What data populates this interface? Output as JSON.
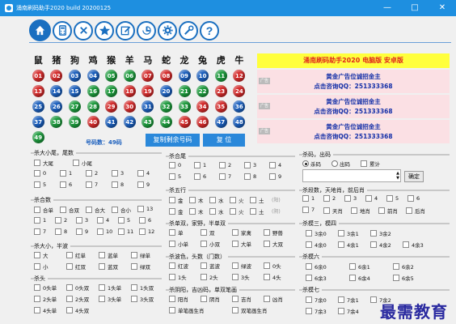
{
  "window": {
    "title": "涌南刷码助手2020 build 20200125",
    "min_glyph": "—",
    "max_glyph": "□",
    "close_glyph": "✕"
  },
  "toolbar": {
    "icons": [
      "home-icon",
      "calculator-icon",
      "close-circle-icon",
      "star-icon",
      "edit-icon",
      "clock-icon",
      "gear-icon",
      "tools-icon",
      "help-icon"
    ],
    "help_glyph": "?"
  },
  "zodiac": [
    "鼠",
    "猪",
    "狗",
    "鸡",
    "猴",
    "羊",
    "马",
    "蛇",
    "龙",
    "兔",
    "虎",
    "牛"
  ],
  "balls": [
    {
      "n": "01",
      "c": "red"
    },
    {
      "n": "02",
      "c": "red"
    },
    {
      "n": "03",
      "c": "blue"
    },
    {
      "n": "04",
      "c": "blue"
    },
    {
      "n": "05",
      "c": "green"
    },
    {
      "n": "06",
      "c": "green"
    },
    {
      "n": "07",
      "c": "red"
    },
    {
      "n": "08",
      "c": "red"
    },
    {
      "n": "09",
      "c": "blue"
    },
    {
      "n": "10",
      "c": "blue"
    },
    {
      "n": "11",
      "c": "green"
    },
    {
      "n": "12",
      "c": "red"
    },
    {
      "n": "13",
      "c": "red"
    },
    {
      "n": "14",
      "c": "blue"
    },
    {
      "n": "15",
      "c": "blue"
    },
    {
      "n": "16",
      "c": "green"
    },
    {
      "n": "17",
      "c": "green"
    },
    {
      "n": "18",
      "c": "red"
    },
    {
      "n": "19",
      "c": "red"
    },
    {
      "n": "20",
      "c": "blue"
    },
    {
      "n": "21",
      "c": "green"
    },
    {
      "n": "22",
      "c": "green"
    },
    {
      "n": "23",
      "c": "red"
    },
    {
      "n": "24",
      "c": "red"
    },
    {
      "n": "25",
      "c": "blue"
    },
    {
      "n": "26",
      "c": "blue"
    },
    {
      "n": "27",
      "c": "green"
    },
    {
      "n": "28",
      "c": "green"
    },
    {
      "n": "29",
      "c": "red"
    },
    {
      "n": "30",
      "c": "red"
    },
    {
      "n": "31",
      "c": "blue"
    },
    {
      "n": "32",
      "c": "green"
    },
    {
      "n": "33",
      "c": "green"
    },
    {
      "n": "34",
      "c": "red"
    },
    {
      "n": "35",
      "c": "red"
    },
    {
      "n": "36",
      "c": "blue"
    },
    {
      "n": "37",
      "c": "blue"
    },
    {
      "n": "38",
      "c": "green"
    },
    {
      "n": "39",
      "c": "green"
    },
    {
      "n": "40",
      "c": "red"
    },
    {
      "n": "41",
      "c": "blue"
    },
    {
      "n": "42",
      "c": "blue"
    },
    {
      "n": "43",
      "c": "green"
    },
    {
      "n": "44",
      "c": "green"
    },
    {
      "n": "45",
      "c": "red"
    },
    {
      "n": "46",
      "c": "red"
    },
    {
      "n": "47",
      "c": "blue"
    },
    {
      "n": "48",
      "c": "blue"
    },
    {
      "n": "49",
      "c": "green"
    }
  ],
  "ball_colors": {
    "red": "#d42a2a",
    "blue": "#1b5fbd",
    "green": "#1c9a3c"
  },
  "num_count_label": "号码数：49码",
  "buttons": {
    "copy": "复制剩余号码",
    "reset": "复 位"
  },
  "ads": {
    "header": "涌南刷码助手2020  电脑版  安卓版",
    "tag": "广告",
    "line1": "黄金广告位诚招金主",
    "line2": "点击咨询QQ：251333368",
    "count": 3
  },
  "col1": {
    "g1": {
      "title": "杀大小尾，尾数",
      "row1": [
        "大尾",
        "小尾"
      ],
      "row2": [
        "0",
        "1",
        "2",
        "3",
        "4"
      ],
      "row3": [
        "5",
        "6",
        "7",
        "8",
        "9"
      ]
    },
    "g2": {
      "title": "杀合数",
      "row1": [
        "合单",
        "合双",
        "合大",
        "合小",
        "13"
      ],
      "row2": [
        "1",
        "2",
        "3",
        "4",
        "5",
        "6"
      ],
      "row3": [
        "7",
        "8",
        "9",
        "10",
        "11",
        "12"
      ]
    },
    "g3": {
      "title": "杀大小，半波",
      "row1": [
        "大",
        "红单",
        "蓝单",
        "绿单"
      ],
      "row2": [
        "小",
        "红双",
        "蓝双",
        "绿双"
      ]
    },
    "g4": {
      "title": "杀头",
      "row1": [
        "0头单",
        "0头双",
        "1头单",
        "1头双"
      ],
      "row2": [
        "2头单",
        "2头双",
        "3头单",
        "3头双"
      ],
      "row3": [
        "4头单",
        "4头双"
      ]
    }
  },
  "col2": {
    "g1": {
      "title": "杀合尾",
      "row1": [
        "0",
        "1",
        "2",
        "3",
        "4"
      ],
      "row2": [
        "5",
        "6",
        "7",
        "8",
        "9"
      ]
    },
    "g2": {
      "title": "杀五行",
      "row1": [
        "金",
        "木",
        "水",
        "火",
        "土"
      ],
      "row1_extra": "(阳)",
      "row2": [
        "金",
        "木",
        "水",
        "火",
        "土"
      ],
      "row2_extra": "(阴)"
    },
    "g3": {
      "title": "杀单双，家野，半单双",
      "row1": [
        "单",
        "双",
        "家禽",
        "野兽"
      ],
      "row2": [
        "小单",
        "小双",
        "大单",
        "大双"
      ]
    },
    "g4": {
      "title": "杀波色，头数（门数）",
      "row1": [
        "红波",
        "蓝波",
        "绿波",
        "0头"
      ],
      "row2": [
        "1头",
        "2头",
        "3头",
        "4头"
      ]
    },
    "g5": {
      "title": "杀阴阳，吉凶码，单双笔画",
      "row1": [
        "阳肖",
        "阴肖",
        "吉肖",
        "凶肖"
      ],
      "row2": [
        "单笔画生肖",
        "双笔画生肖"
      ]
    }
  },
  "col3": {
    "g1": {
      "title": "杀码，出码",
      "radios": [
        "杀码",
        "出码",
        "累计"
      ],
      "ok": "确定"
    },
    "g2": {
      "title": "杀段数，天地肖，前后肖",
      "row1": [
        "1",
        "2",
        "3",
        "4",
        "5",
        "6"
      ],
      "row2": [
        "7",
        "天肖",
        "地肖",
        "前肖",
        "后肖"
      ]
    },
    "g3": {
      "title": "杀模三，模四",
      "row1": [
        "3余0",
        "3余1",
        "3余2"
      ],
      "row2": [
        "4余0",
        "4余1",
        "4余2",
        "4余3"
      ]
    },
    "g4": {
      "title": "杀模六",
      "row1": [
        "6余0",
        "6余1",
        "6余2"
      ],
      "row2": [
        "6余3",
        "6余4",
        "6余5"
      ]
    },
    "g5": {
      "title": "杀模七",
      "row1": [
        "7余0",
        "7余1",
        "7余2"
      ],
      "row2": [
        "7余3",
        "7余4"
      ]
    }
  },
  "watermark": "最需教育"
}
